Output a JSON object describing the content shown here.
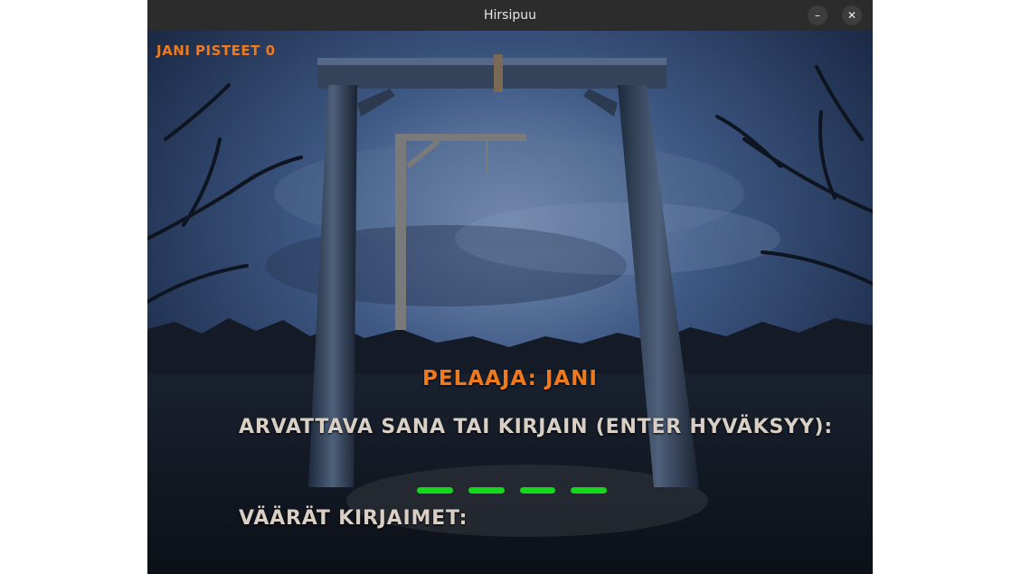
{
  "window": {
    "title": "Hirsipuu",
    "minimize_glyph": "–",
    "close_glyph": "✕"
  },
  "hud": {
    "score_text": "JANI PISTEET 0"
  },
  "game": {
    "player_text": "PELAAJA: JANI",
    "prompt_text": "ARVATTAVA SANA TAI KIRJAIN (ENTER HYVÄKSYY):",
    "wrong_letters_label": "VÄÄRÄT KIRJAIMET:",
    "word_length": 4,
    "colors": {
      "accent_orange": "#ef7a1d",
      "label_beige": "#d9cfc4",
      "blank_green": "#13d91a",
      "gallows_gray": "#7a7a7a"
    }
  }
}
